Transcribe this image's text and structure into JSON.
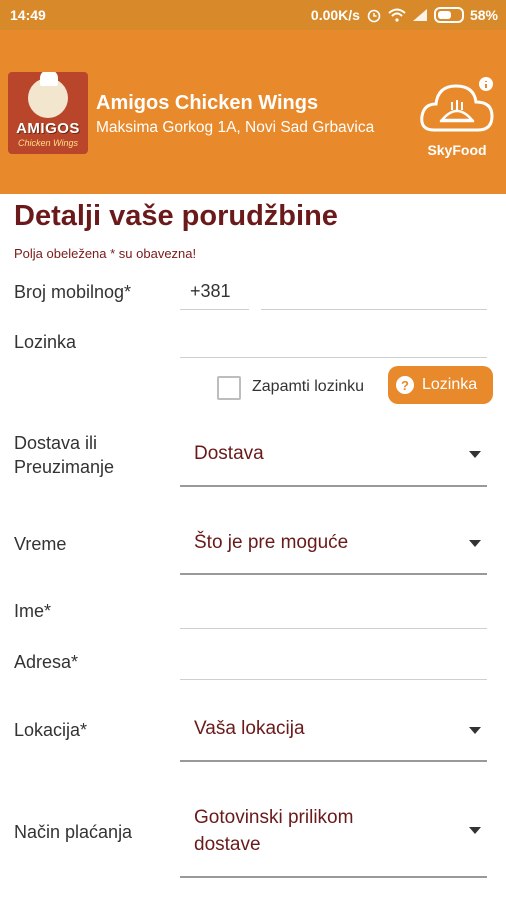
{
  "status_bar": {
    "time": "14:49",
    "network_speed": "0.00K/s",
    "battery": "58%"
  },
  "header": {
    "logo_brand": "AMIGOS",
    "logo_sub": "Chicken Wings",
    "restaurant_name": "Amigos Chicken Wings",
    "restaurant_address": "Maksima Gorkog 1A, Novi Sad Grbavica",
    "skyfood_label": "SkyFood",
    "accent_color": "#e8892b"
  },
  "form": {
    "title": "Detalji vaše porudžbine",
    "required_note": "Polja obeležena * su obavezna!",
    "phone_label": "Broj mobilnog*",
    "phone_prefix": "+381",
    "phone_value": "",
    "password_label": "Lozinka",
    "password_value": "",
    "remember_label": "Zapamti lozinku",
    "remember_checked": false,
    "password_button": "Lozinka",
    "delivery_label_line1": "Dostava ili",
    "delivery_label_line2": "Preuzimanje",
    "delivery_value": "Dostava",
    "time_label": "Vreme",
    "time_value": "Što je pre moguće",
    "name_label": "Ime*",
    "name_value": "",
    "address_label": "Adresa*",
    "address_value": "",
    "location_label": "Lokacija*",
    "location_value": "Vaša lokacija",
    "payment_label": "Način plaćanja",
    "payment_value_line1": "Gotovinski prilikom",
    "payment_value_line2": "dostave"
  }
}
